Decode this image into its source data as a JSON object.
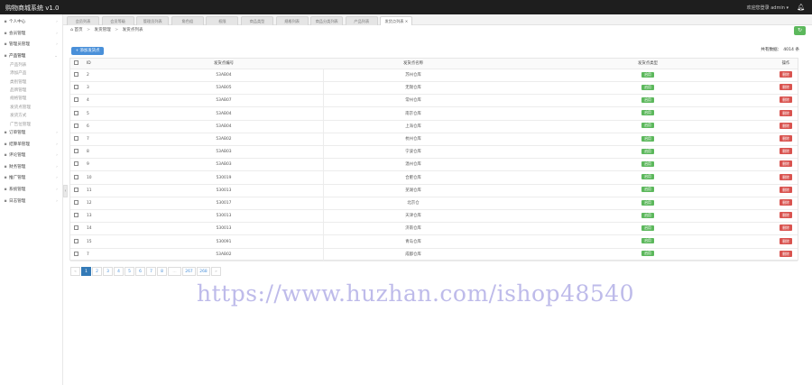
{
  "app": {
    "brand": "购物商城系统 v1.0",
    "user_label": "欢迎您登录 admin  ▾",
    "bell_icon": "bell-icon"
  },
  "sidebar": {
    "items": [
      {
        "label": "个人中心",
        "type": "group"
      },
      {
        "label": "会员管理",
        "type": "group"
      },
      {
        "label": "管理员管理",
        "type": "group"
      },
      {
        "label": "产品管理",
        "type": "group-open"
      },
      {
        "label": "产品列表",
        "type": "sub"
      },
      {
        "label": "添加产品",
        "type": "sub"
      },
      {
        "label": "类别管理",
        "type": "sub"
      },
      {
        "label": "品牌管理",
        "type": "sub"
      },
      {
        "label": "规格管理",
        "type": "sub"
      },
      {
        "label": "发货点管理",
        "type": "sub"
      },
      {
        "label": "发货方式",
        "type": "sub"
      },
      {
        "label": "广告位管理",
        "type": "sub"
      },
      {
        "label": "订单管理",
        "type": "group"
      },
      {
        "label": "结算单管理",
        "type": "group"
      },
      {
        "label": "评论管理",
        "type": "group"
      },
      {
        "label": "财务管理",
        "type": "group"
      },
      {
        "label": "推广管理",
        "type": "group"
      },
      {
        "label": "系统管理",
        "type": "group"
      },
      {
        "label": "日志管理",
        "type": "group"
      }
    ]
  },
  "tabs": [
    "会员列表",
    "会员等级",
    "管理员列表",
    "角色组",
    "权限",
    "商品类型",
    "规格列表",
    "商品分类列表",
    "产品列表",
    "发货点列表 ×"
  ],
  "breadcrumb": {
    "home": "首页",
    "section": "发货管理",
    "page": "发货点列表"
  },
  "toolbar": {
    "add_label": "+ 添加发货点",
    "total_label": "共有数据：",
    "total_count": "4014 条"
  },
  "table": {
    "headers": {
      "id": "ID",
      "code": "发货点编号",
      "name": "发货点名称",
      "type": "发货点类型",
      "op": "操作"
    },
    "rows": [
      {
        "id": "2",
        "code": "53AB04",
        "name": "苏州仓库",
        "type": "启用",
        "op": "删除"
      },
      {
        "id": "3",
        "code": "53AB05",
        "name": "无锡仓库",
        "type": "启用",
        "op": "删除"
      },
      {
        "id": "4",
        "code": "53AB07",
        "name": "常州仓库",
        "type": "启用",
        "op": "删除"
      },
      {
        "id": "5",
        "code": "53AB04",
        "name": "南京仓库",
        "type": "启用",
        "op": "删除"
      },
      {
        "id": "6",
        "code": "53AB04",
        "name": "上海仓库",
        "type": "启用",
        "op": "删除"
      },
      {
        "id": "7",
        "code": "53AB02",
        "name": "杭州仓库",
        "type": "启用",
        "op": "删除"
      },
      {
        "id": "8",
        "code": "53AB03",
        "name": "宁波仓库",
        "type": "启用",
        "op": "删除"
      },
      {
        "id": "9",
        "code": "53AB03",
        "name": "温州仓库",
        "type": "启用",
        "op": "删除"
      },
      {
        "id": "10",
        "code": "530019",
        "name": "合肥仓库",
        "type": "启用",
        "op": "删除"
      },
      {
        "id": "11",
        "code": "530013",
        "name": "芜湖仓库",
        "type": "启用",
        "op": "删除"
      },
      {
        "id": "12",
        "code": "530017",
        "name": "北京仓",
        "type": "启用",
        "op": "删除"
      },
      {
        "id": "13",
        "code": "530013",
        "name": "天津仓库",
        "type": "启用",
        "op": "删除"
      },
      {
        "id": "14",
        "code": "530013",
        "name": "济南仓库",
        "type": "启用",
        "op": "删除"
      },
      {
        "id": "15",
        "code": "530091",
        "name": "青岛仓库",
        "type": "启用",
        "op": "删除"
      },
      {
        "id": "7",
        "code": "53AB02",
        "name": "成都仓库",
        "type": "启用",
        "op": "删除"
      }
    ]
  },
  "pager": {
    "prev": "«",
    "pages": [
      "1",
      "2",
      "3",
      "4",
      "5",
      "6",
      "7",
      "8",
      "...",
      "267",
      "268"
    ],
    "next": "»",
    "active": "1"
  },
  "watermark": "https://www.huzhan.com/ishop48540",
  "colors": {
    "topbar": "#1e1e1e",
    "primary": "#4a90d9",
    "success": "#5cb85c",
    "danger": "#d9534f",
    "watermark": "#b7b4e8"
  }
}
